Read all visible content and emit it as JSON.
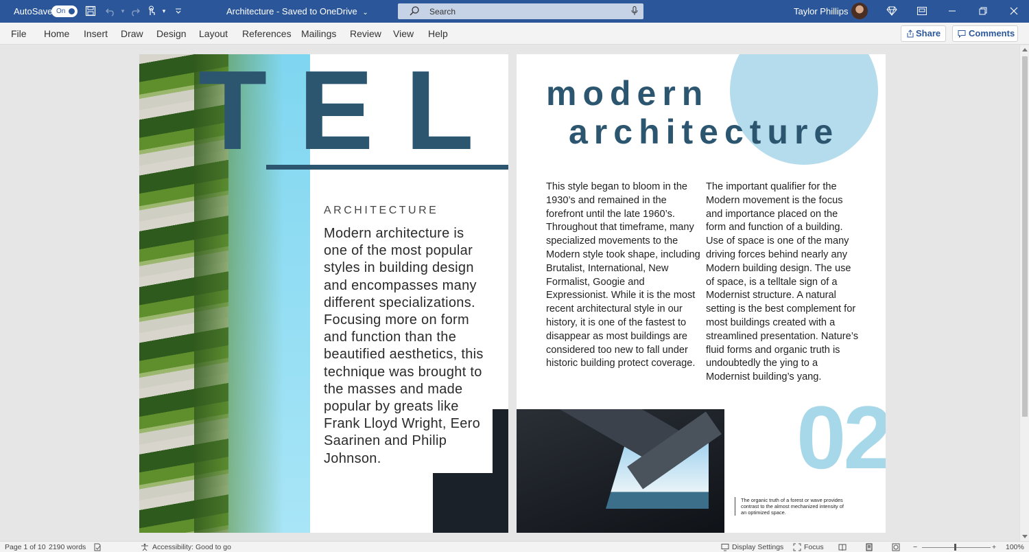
{
  "titlebar": {
    "autosave_label": "AutoSave",
    "autosave_state": "On",
    "doc_title": "Architecture - Saved to OneDrive",
    "search_placeholder": "Search",
    "user_name": "Taylor Phillips",
    "bg_color": "#2b579a"
  },
  "ribbon": {
    "tabs": [
      "File",
      "Home",
      "Insert",
      "Draw",
      "Design",
      "Layout",
      "References",
      "Mailings",
      "Review",
      "View",
      "Help"
    ],
    "share_label": "Share",
    "comments_label": "Comments"
  },
  "left_page": {
    "big_word": "TELL",
    "kicker": "ARCHITECTURE",
    "lead": "Modern architecture is one of the most popular styles in building design and encompasses many different specializations. Focusing more on form and function than the beautified aesthetics, this technique was brought to the masses and made popular by greats like Frank Lloyd Wright, Eero Saarinen and Philip Johnson."
  },
  "right_page": {
    "heading_line1": "modern",
    "heading_line2": "architecture",
    "col1": "This style began to bloom in the 1930’s and remained in the forefront until the late 1960’s. Throughout that timeframe, many specialized movements to the Modern style took shape, including Brutalist, International, New Formalist, Googie and Expressionist. While it is the most recent architectural style in our history, it is one of the fastest to disappear as most buildings are considered too new to fall under historic building protect coverage.",
    "col2": "The important qualifier for the Modern movement is the focus and importance placed on the form and function of a building. Use of space is one of the many driving forces behind nearly any Modern building design. The use of space, is a telltale sign of a Modernist structure. A natural setting is the best complement for most buildings created with a streamlined presentation. Nature’s fluid forms and organic truth is undoubtedly the ying to a Modernist building’s yang.",
    "page_number": "02",
    "caption": "The organic truth of a forest or wave provides contrast to the almost mechanized intensity of an optimized space."
  },
  "statusbar": {
    "page_info": "Page 1 of 10",
    "word_count": "2190 words",
    "accessibility": "Accessibility: Good to go",
    "display_settings": "Display Settings",
    "focus": "Focus",
    "zoom_minus": "−",
    "zoom_plus": "+",
    "zoom_level": "100%"
  },
  "colors": {
    "accent_dark": "#2c5670",
    "accent_light": "#a7d8ea",
    "circle": "#b5dcec"
  }
}
